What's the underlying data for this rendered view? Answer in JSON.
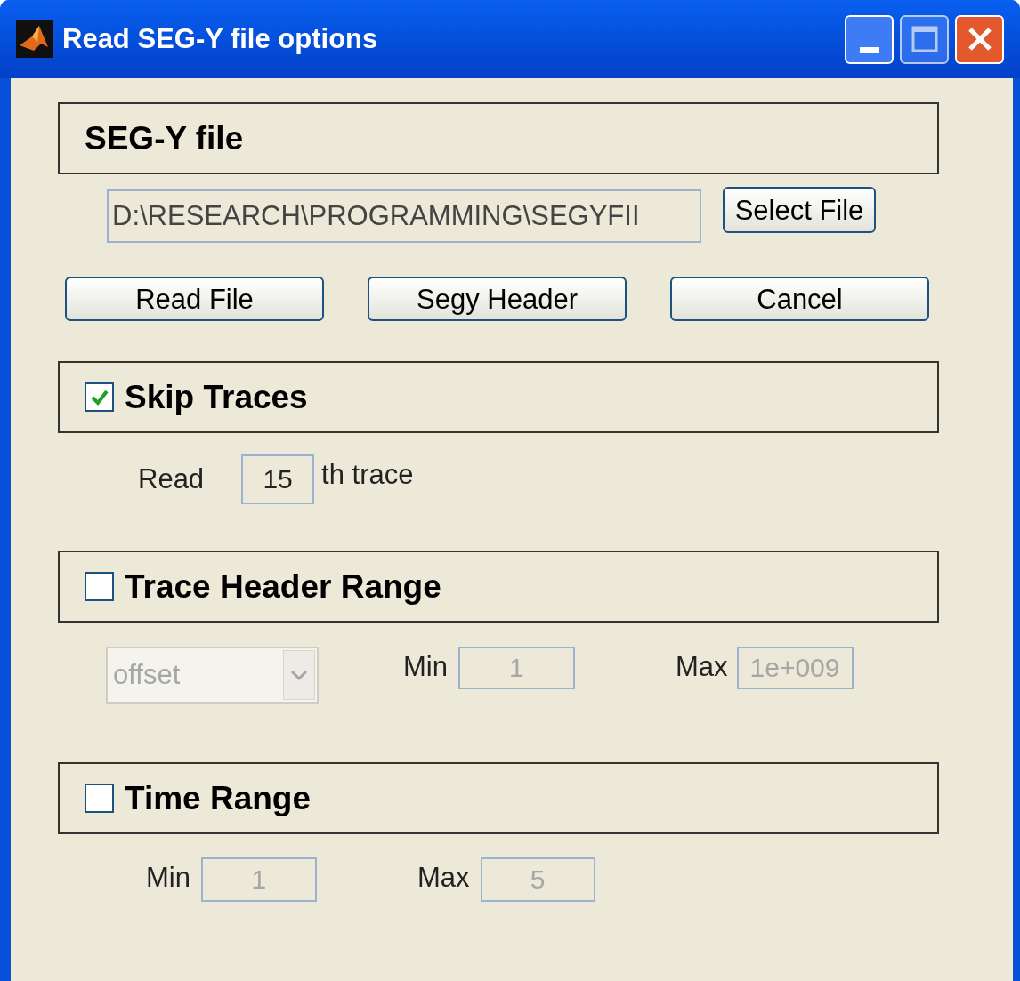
{
  "window": {
    "title": "Read SEG-Y file options"
  },
  "file_section": {
    "title": "SEG-Y file",
    "path": "D:\\RESEARCH\\PROGRAMMING\\SEGYFII",
    "select_button": "Select File"
  },
  "buttons": [
    "Read File",
    "Segy Header",
    "Cancel"
  ],
  "skip_traces": {
    "label": "Skip Traces",
    "checked": true,
    "prefix": "Read",
    "value": "15",
    "disabled": false,
    "suffix": "th trace"
  },
  "trace_header_range": {
    "label": "Trace Header Range",
    "checked": false,
    "dropdown": {
      "value": "offset",
      "disabled": true
    },
    "min_label": "Min",
    "min": {
      "value": "1",
      "disabled": true
    },
    "max_label": "Max",
    "max": {
      "value": "1e+009",
      "disabled": true
    }
  },
  "time_range": {
    "label": "Time Range",
    "checked": false,
    "min_label": "Min",
    "min": {
      "value": "1",
      "disabled": true
    },
    "max_label": "Max",
    "max": {
      "value": "5",
      "disabled": true
    }
  }
}
